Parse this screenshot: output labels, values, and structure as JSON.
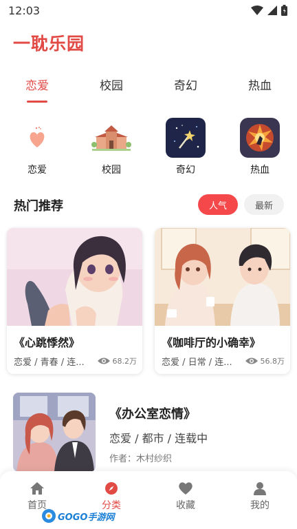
{
  "status": {
    "time": "12:03"
  },
  "app": {
    "title": "一耽乐园"
  },
  "tabs": [
    {
      "label": "恋爱",
      "active": true
    },
    {
      "label": "校园",
      "active": false
    },
    {
      "label": "奇幻",
      "active": false
    },
    {
      "label": "热血",
      "active": false
    }
  ],
  "categories": [
    {
      "label": "恋爱",
      "icon": "heart-icon"
    },
    {
      "label": "校园",
      "icon": "school-icon"
    },
    {
      "label": "奇幻",
      "icon": "magic-wand-icon"
    },
    {
      "label": "热血",
      "icon": "explosion-icon"
    }
  ],
  "section": {
    "title": "热门推荐",
    "sort_hot": "人气",
    "sort_new": "最新"
  },
  "cards": [
    {
      "title": "《心跳悸然》",
      "meta": "恋爱 / 青春 / 连...",
      "views": "68.2万"
    },
    {
      "title": "《咖啡厅的小确幸》",
      "meta": "恋爱 / 日常 / 连...",
      "views": "56.8万"
    }
  ],
  "list": [
    {
      "title": "《办公室恋情》",
      "meta": "恋爱 / 都市 / 连载中",
      "author": "作者：木村纱织"
    }
  ],
  "nav": [
    {
      "label": "首页",
      "icon": "home-icon",
      "active": false
    },
    {
      "label": "分类",
      "icon": "compass-icon",
      "active": true
    },
    {
      "label": "收藏",
      "icon": "heart-icon",
      "active": false
    },
    {
      "label": "我的",
      "icon": "user-icon",
      "active": false
    }
  ],
  "watermark": {
    "text": "GOGO手游网"
  },
  "colors": {
    "accent": "#e24a46",
    "pill_active": "#f4484b"
  }
}
